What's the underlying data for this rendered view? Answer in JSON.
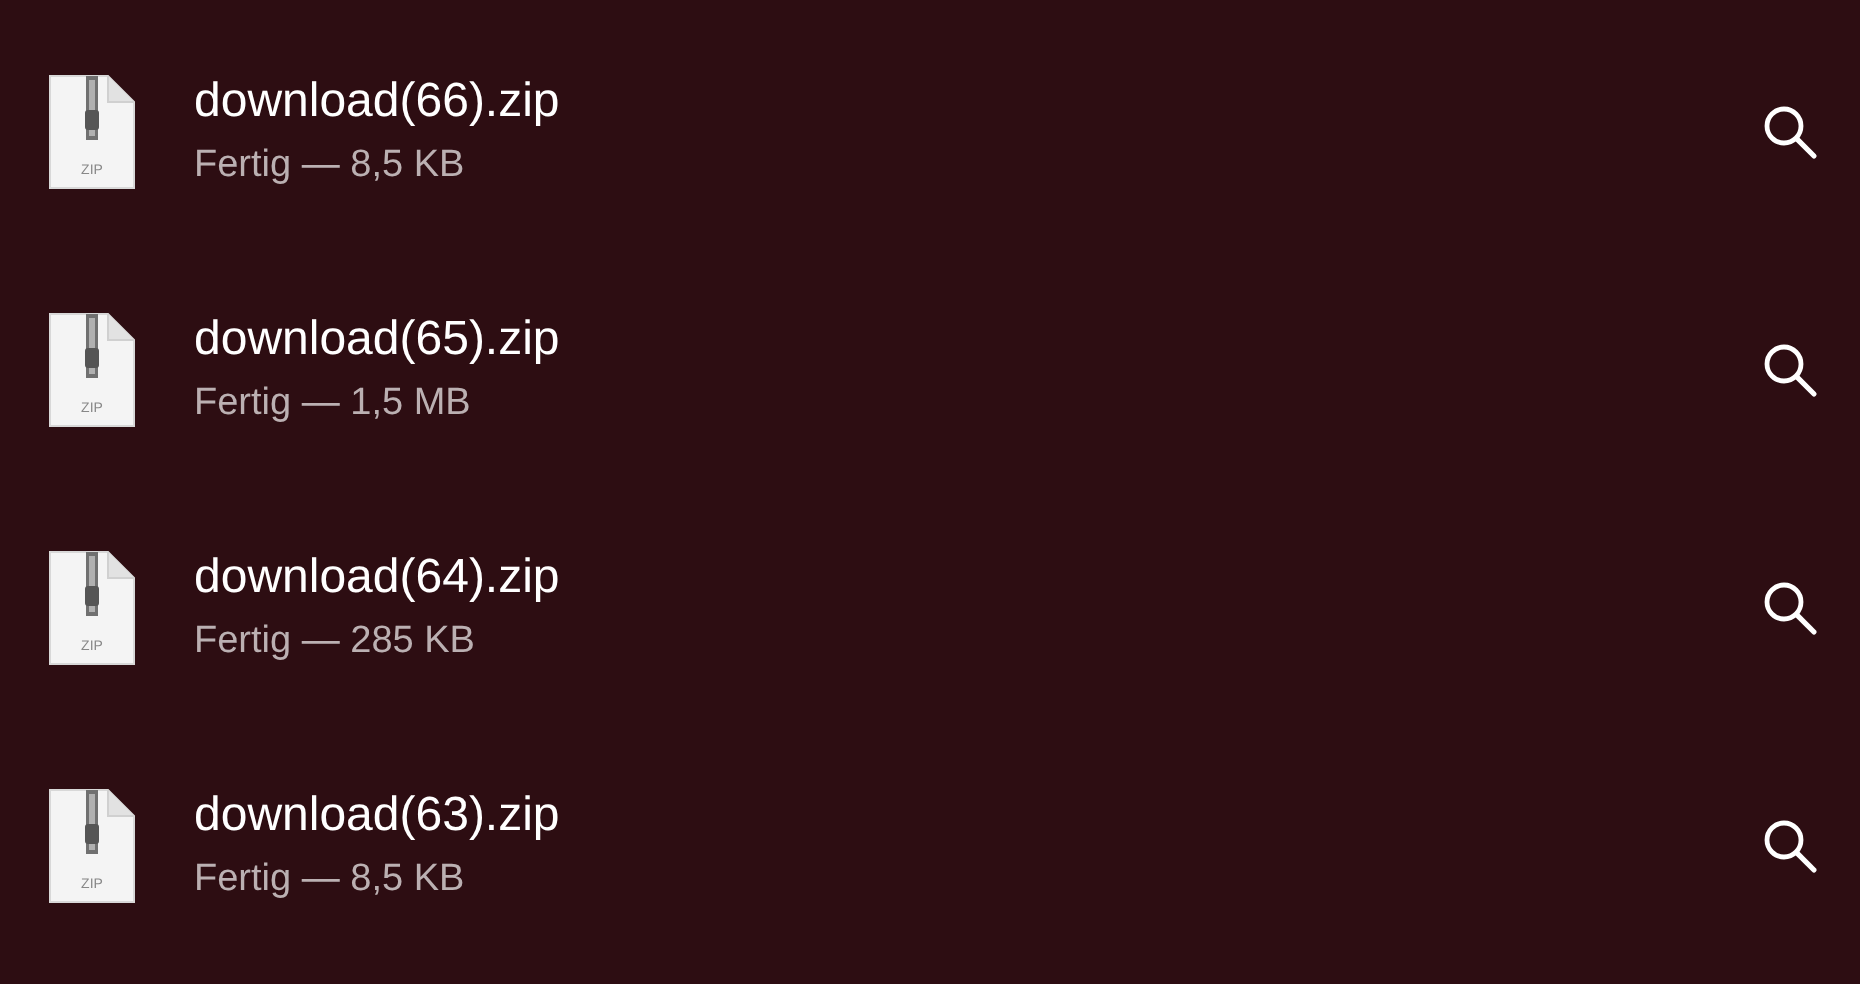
{
  "downloads": [
    {
      "name": "download(66).zip",
      "status": "Fertig — 8,5 KB",
      "icon_label": "ZIP"
    },
    {
      "name": "download(65).zip",
      "status": "Fertig — 1,5 MB",
      "icon_label": "ZIP"
    },
    {
      "name": "download(64).zip",
      "status": "Fertig — 285 KB",
      "icon_label": "ZIP"
    },
    {
      "name": "download(63).zip",
      "status": "Fertig — 8,5 KB",
      "icon_label": "ZIP"
    }
  ]
}
